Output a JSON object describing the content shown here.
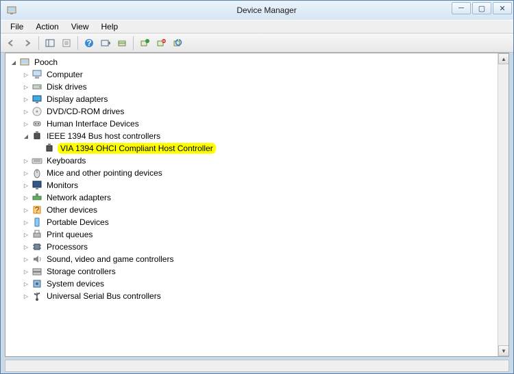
{
  "window": {
    "title": "Device Manager"
  },
  "menu": {
    "items": [
      "File",
      "Action",
      "View",
      "Help"
    ]
  },
  "tree": {
    "root": "Pooch",
    "nodes": [
      {
        "label": "Computer",
        "icon": "computer",
        "expanded": false,
        "depth": 1
      },
      {
        "label": "Disk drives",
        "icon": "disk",
        "expanded": false,
        "depth": 1
      },
      {
        "label": "Display adapters",
        "icon": "display",
        "expanded": false,
        "depth": 1
      },
      {
        "label": "DVD/CD-ROM drives",
        "icon": "dvd",
        "expanded": false,
        "depth": 1
      },
      {
        "label": "Human Interface Devices",
        "icon": "hid",
        "expanded": false,
        "depth": 1
      },
      {
        "label": "IEEE 1394 Bus host controllers",
        "icon": "ieee1394",
        "expanded": true,
        "depth": 1
      },
      {
        "label": "VIA 1394 OHCI Compliant Host Controller",
        "icon": "ieee1394",
        "expanded": null,
        "depth": 2,
        "highlight": true
      },
      {
        "label": "Keyboards",
        "icon": "keyboard",
        "expanded": false,
        "depth": 1
      },
      {
        "label": "Mice and other pointing devices",
        "icon": "mouse",
        "expanded": false,
        "depth": 1
      },
      {
        "label": "Monitors",
        "icon": "monitor",
        "expanded": false,
        "depth": 1
      },
      {
        "label": "Network adapters",
        "icon": "network",
        "expanded": false,
        "depth": 1
      },
      {
        "label": "Other devices",
        "icon": "other",
        "expanded": false,
        "depth": 1
      },
      {
        "label": "Portable Devices",
        "icon": "portable",
        "expanded": false,
        "depth": 1
      },
      {
        "label": "Print queues",
        "icon": "printer",
        "expanded": false,
        "depth": 1
      },
      {
        "label": "Processors",
        "icon": "cpu",
        "expanded": false,
        "depth": 1
      },
      {
        "label": "Sound, video and game controllers",
        "icon": "sound",
        "expanded": false,
        "depth": 1
      },
      {
        "label": "Storage controllers",
        "icon": "storage",
        "expanded": false,
        "depth": 1
      },
      {
        "label": "System devices",
        "icon": "system",
        "expanded": false,
        "depth": 1
      },
      {
        "label": "Universal Serial Bus controllers",
        "icon": "usb",
        "expanded": false,
        "depth": 1
      }
    ]
  }
}
